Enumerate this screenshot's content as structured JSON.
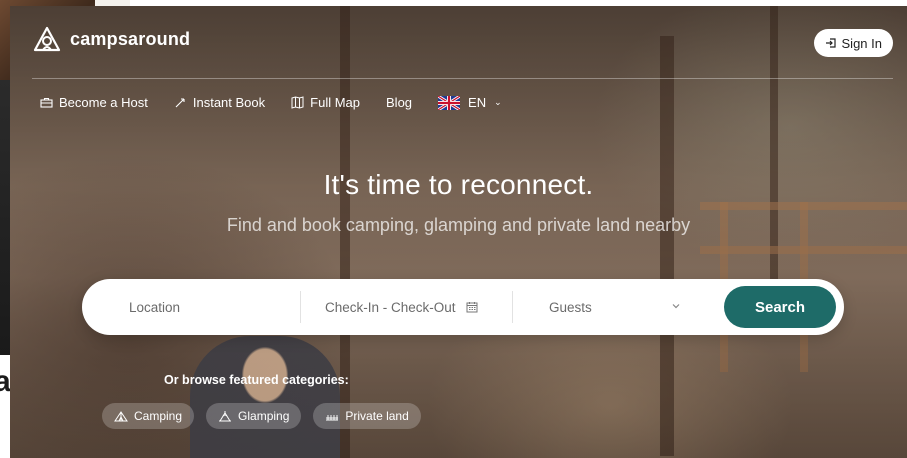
{
  "brand": {
    "name": "campsaround",
    "icon": "campsaround-logo-icon"
  },
  "header": {
    "sign_in_label": "Sign In",
    "sign_in_icon": "sign-in-icon"
  },
  "nav": {
    "items": [
      {
        "label": "Become a Host",
        "icon": "briefcase-icon"
      },
      {
        "label": "Instant Book",
        "icon": "rocket-icon"
      },
      {
        "label": "Full Map",
        "icon": "map-icon"
      },
      {
        "label": "Blog",
        "icon": ""
      }
    ],
    "language": {
      "code": "EN",
      "icon": "uk-flag-icon"
    }
  },
  "hero": {
    "headline": "It's time to reconnect.",
    "subheadline": "Find and book camping, glamping and private land nearby"
  },
  "search": {
    "location_placeholder": "Location",
    "dates_placeholder": "Check-In - Check-Out",
    "guests_placeholder": "Guests",
    "button_label": "Search",
    "button_color": "#1e6b68"
  },
  "categories": {
    "heading": "Or browse featured categories:",
    "items": [
      {
        "label": "Camping",
        "icon": "tent-icon"
      },
      {
        "label": "Glamping",
        "icon": "glamping-icon"
      },
      {
        "label": "Private land",
        "icon": "private-land-icon"
      }
    ]
  },
  "background": {
    "caption_fragment": "asses"
  }
}
